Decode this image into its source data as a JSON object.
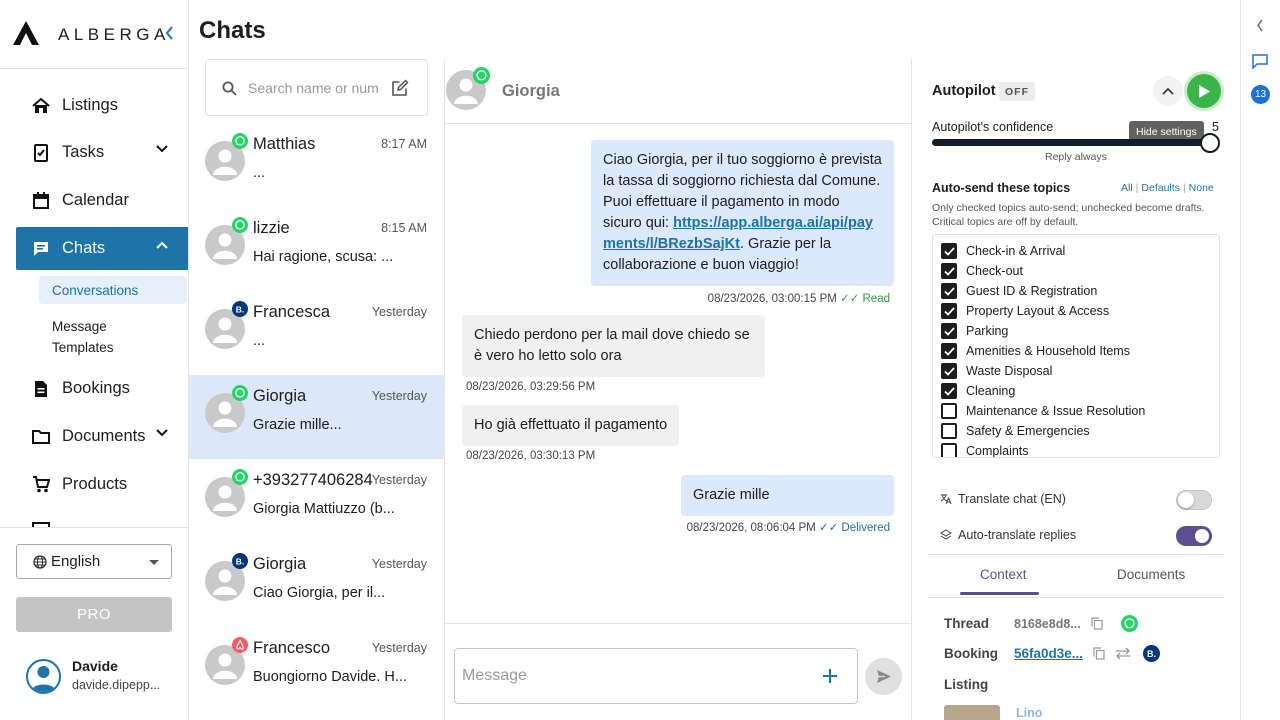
{
  "brand": {
    "name": "ALBERGA"
  },
  "nav": {
    "items": [
      {
        "label": "Listings"
      },
      {
        "label": "Tasks"
      },
      {
        "label": "Calendar"
      },
      {
        "label": "Chats"
      },
      {
        "label": "Bookings"
      },
      {
        "label": "Documents"
      },
      {
        "label": "Products"
      }
    ],
    "chats_sub": [
      {
        "label": "Conversations"
      },
      {
        "label": "Message Templates"
      }
    ],
    "language": "English",
    "pro_label": "PRO",
    "user": {
      "name": "Davide",
      "email": "davide.dipepp..."
    }
  },
  "chats": {
    "title": "Chats",
    "search_placeholder": "Search name or number",
    "conversations": [
      {
        "name": "Matthias",
        "time": "8:17 AM",
        "preview": "...",
        "channel": "whatsapp"
      },
      {
        "name": "lizzie",
        "time": "8:15 AM",
        "preview": "Hai ragione, scusa: ...",
        "channel": "whatsapp"
      },
      {
        "name": "Francesca",
        "time": "Yesterday",
        "preview": "...",
        "channel": "booking",
        "badge_text": "B."
      },
      {
        "name": "Giorgia",
        "time": "Yesterday",
        "preview": "Grazie mille...",
        "channel": "whatsapp",
        "selected": true
      },
      {
        "name": "+393277406284",
        "time": "Yesterday",
        "preview": "Giorgia Mattiuzzo (b...",
        "channel": "whatsapp"
      },
      {
        "name": "Giorgia",
        "time": "Yesterday",
        "preview": "Ciao Giorgia, per il...",
        "channel": "booking",
        "badge_text": "B."
      },
      {
        "name": "Francesco",
        "time": "Yesterday",
        "preview": "Buongiorno Davide. H...",
        "channel": "airbnb"
      }
    ]
  },
  "thread": {
    "contact_name": "Giorgia",
    "messages": [
      {
        "direction": "out",
        "text_before_link": "Ciao Giorgia, per il tuo soggiorno è prevista la tassa di soggiorno richiesta dal Comune. Puoi effettuare il pagamento in modo sicuro qui: ",
        "link": "https://app.alberga.ai/api/payments/l/BRezbSajKt",
        "text_after_link": ". Grazie per la collaborazione e buon viaggio!",
        "timestamp": "08/23/2026, 03:00:15 PM",
        "status": "✓✓ Read"
      },
      {
        "direction": "in",
        "text": "Chiedo perdono per la mail dove chiedo se è vero ho letto solo ora",
        "timestamp": "08/23/2026, 03:29:56 PM"
      },
      {
        "direction": "in",
        "text": "Ho già effettuato il pagamento",
        "timestamp": "08/23/2026, 03:30:13 PM"
      },
      {
        "direction": "out",
        "text": "Grazie mille",
        "timestamp": "08/23/2026, 08:06:04 PM",
        "status": "✓✓ Delivered"
      }
    ],
    "composer_placeholder": "Message"
  },
  "autopilot": {
    "title": "Autopilot",
    "state": "OFF",
    "tooltip": "Hide settings",
    "confidence_label": "Autopilot's confidence",
    "confidence_value": "5",
    "confidence_fraction": 1.0,
    "slider_caption": "Reply always",
    "topics_title": "Auto-send these topics",
    "topic_links": [
      "All",
      "Defaults",
      "None"
    ],
    "topics_note": "Only checked topics auto-send; unchecked become drafts. Critical topics are off by default.",
    "topics": [
      {
        "label": "Check-in & Arrival",
        "checked": true
      },
      {
        "label": "Check-out",
        "checked": true
      },
      {
        "label": "Guest ID & Registration",
        "checked": true
      },
      {
        "label": "Property Layout & Access",
        "checked": true
      },
      {
        "label": "Parking",
        "checked": true
      },
      {
        "label": "Amenities & Household Items",
        "checked": true
      },
      {
        "label": "Waste Disposal",
        "checked": true
      },
      {
        "label": "Cleaning",
        "checked": true
      },
      {
        "label": "Maintenance & Issue Resolution",
        "checked": false
      },
      {
        "label": "Safety & Emergencies",
        "checked": false
      },
      {
        "label": "Complaints",
        "checked": false
      }
    ],
    "translate_chat_label": "Translate chat (EN)",
    "translate_chat_on": false,
    "auto_translate_label": "Auto-translate replies",
    "auto_translate_on": true
  },
  "context": {
    "tabs": [
      "Context",
      "Documents"
    ],
    "thread_label": "Thread",
    "thread_id": "8168e8d8...",
    "booking_label": "Booking",
    "booking_id": "56fa0d3e...",
    "listing_label": "Listing",
    "listing_name": "Lino"
  },
  "rail": {
    "count": "13"
  },
  "colors": {
    "accent": "#1e73a8",
    "whatsapp": "#25d366",
    "booking": "#003580",
    "airbnb": "#ff5a5f",
    "autopilot_play": "#3bb54a",
    "toggle_on": "#5b4f8e"
  }
}
